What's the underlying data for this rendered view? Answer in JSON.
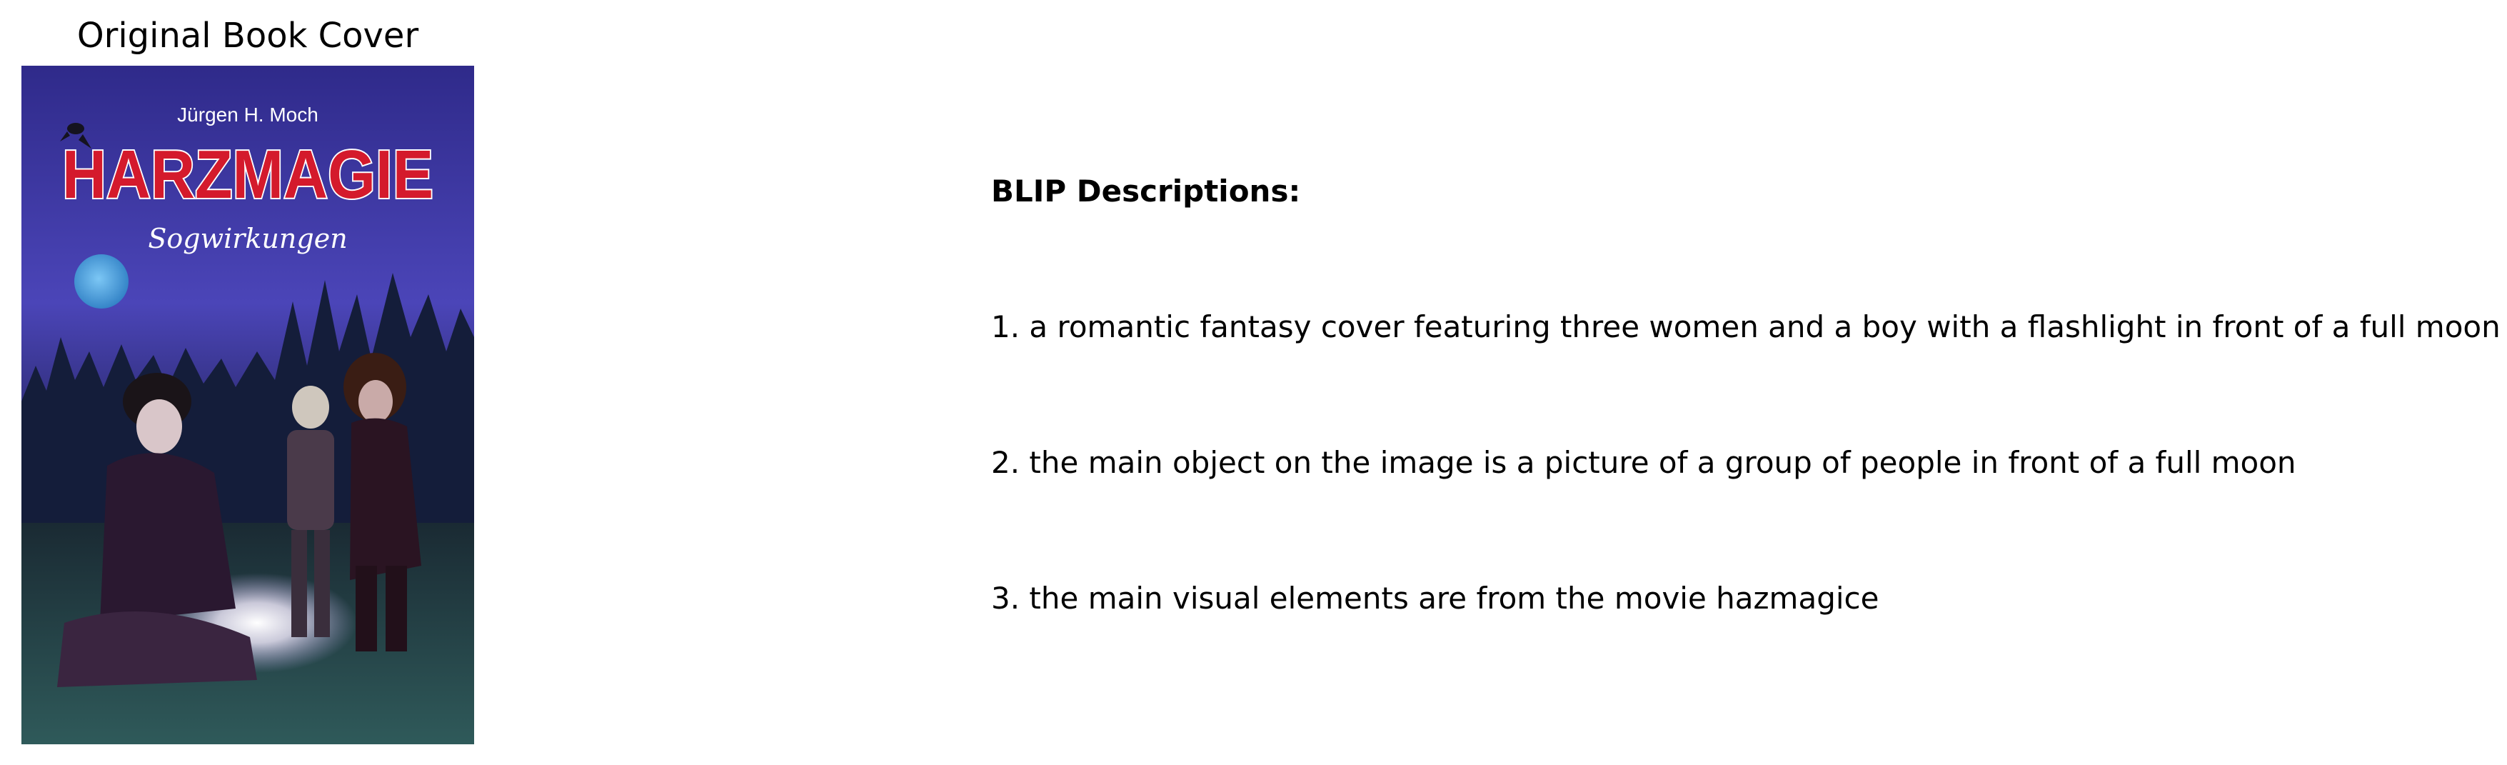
{
  "cover_panel": {
    "title": "Original Book Cover",
    "cover": {
      "author": "Jürgen H. Moch",
      "title": "HARZMAGIE",
      "subtitle": "Sogwirkungen"
    }
  },
  "descriptions": {
    "heading": "BLIP Descriptions:",
    "items": [
      "1. a romantic fantasy cover featuring three women and a boy with a flashlight in front of a full moon",
      "2. the main object on the image is a picture of a group of people in front of a full moon",
      "3. the main visual elements are from the movie hazmagice"
    ]
  },
  "colors": {
    "title_red": "#d41a2c",
    "sky_blue": "#3b3fa8",
    "moon_blue": "#4aa6e8"
  }
}
